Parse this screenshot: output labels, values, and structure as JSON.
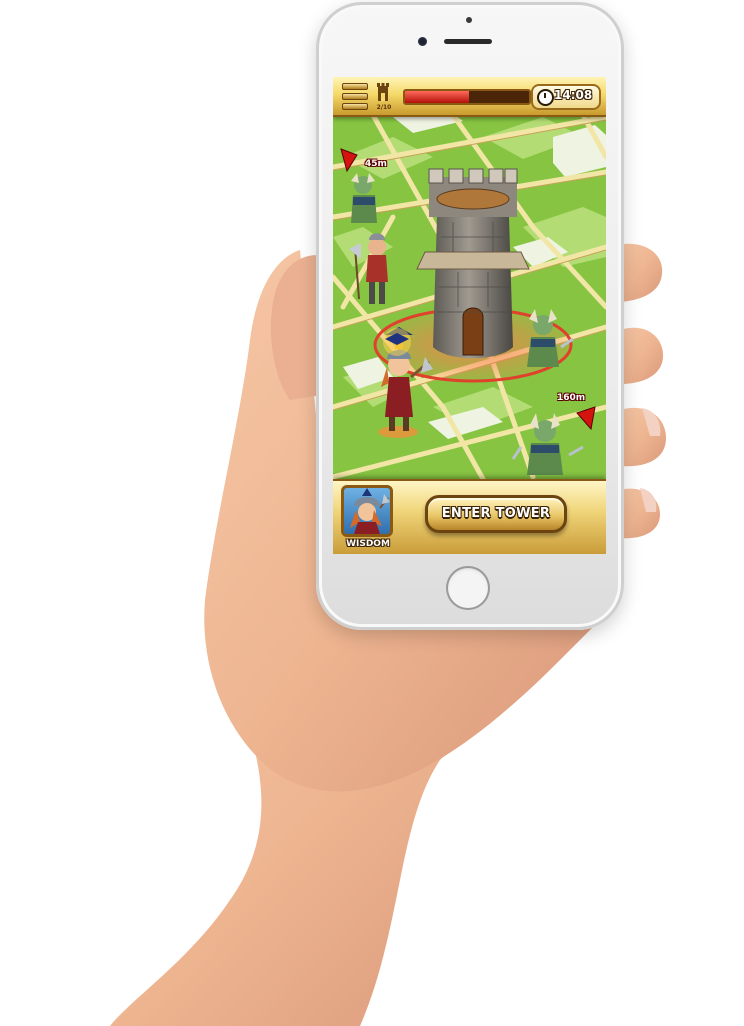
{
  "hud": {
    "tower_count": "2/10",
    "health_fraction": 0.52,
    "timer": "14:08",
    "icons": [
      "menu-icon",
      "tower-icon",
      "clock-icon"
    ]
  },
  "map": {
    "markers": [
      {
        "distance": "45m",
        "icon": "red-arrow-icon"
      },
      {
        "distance": "160m",
        "icon": "red-arrow-icon"
      }
    ],
    "units": [
      "viking-heroine",
      "axeman",
      "horned-orc",
      "horned-orc",
      "horned-orc"
    ]
  },
  "bottom_panel": {
    "hero_label": "WISDOM",
    "enter_button_label": "ENTER TOWER"
  },
  "colors": {
    "grass": "#7fbf3c",
    "road": "#f2e6a6",
    "hud_gold": "#f5d96a",
    "hud_border": "#8a5a14",
    "health_red": "#d11f14"
  }
}
